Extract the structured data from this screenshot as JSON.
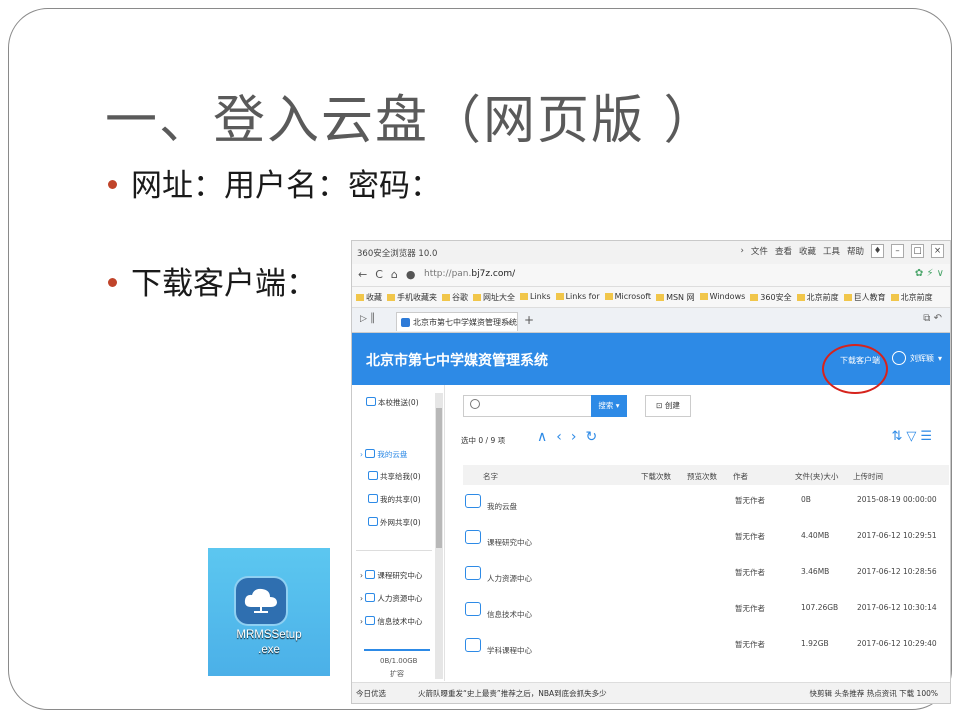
{
  "slide": {
    "title": "一、登入云盘（网页版 ）",
    "bullets": [
      "网址：用户名：密码：",
      "下载客户端："
    ]
  },
  "exe_file": {
    "name_line1": "MRMSSetup",
    "name_line2": ".exe",
    "icon": "cloud-setup-icon"
  },
  "browser": {
    "app_title": "360安全浏览器 10.0",
    "menu": [
      "文件",
      "查看",
      "收藏",
      "工具",
      "帮助"
    ],
    "url_prefix": "http://pan.",
    "url_domain": "bj7z.com/",
    "favorites": [
      "收藏",
      "手机收藏夹",
      "谷歌",
      "网址大全",
      "Links",
      "Links for",
      "Microsoft",
      "MSN 网",
      "Windows",
      "360安全",
      "北京前度",
      "巨人教育",
      "北京前度"
    ],
    "tab_title": "北京市第七中学媒资管理系统",
    "accent_color": "#2d8ae6"
  },
  "app": {
    "header_title": "北京市第七中学媒资管理系统",
    "download_client": "下载客户端",
    "user_name": "刘辉颖",
    "sidebar": {
      "school_push": "本校推送(0)",
      "my_disk": "我的云盘",
      "shared_to_me": "共享给我(0)",
      "my_shares": "我的共享(0)",
      "external_shares": "外网共享(0)",
      "groups": [
        "课程研究中心",
        "人力资源中心",
        "信息技术中心"
      ],
      "quota": "0B/1.00GB",
      "expand": "扩容"
    },
    "toolbar": {
      "search_button": "搜索",
      "create_button": "创建"
    },
    "selection": "选中 0 / 9 项",
    "columns": [
      "名字",
      "下载次数",
      "预览次数",
      "作者",
      "文件(夹)大小",
      "上传时间"
    ],
    "rows": [
      {
        "name": "我的云盘",
        "author": "暂无作者",
        "size": "0B",
        "time": "2015-08-19 00:00:00"
      },
      {
        "name": "课程研究中心",
        "author": "暂无作者",
        "size": "4.40MB",
        "time": "2017-06-12 10:29:51"
      },
      {
        "name": "人力资源中心",
        "author": "暂无作者",
        "size": "3.46MB",
        "time": "2017-06-12 10:28:56"
      },
      {
        "name": "信息技术中心",
        "author": "暂无作者",
        "size": "107.26GB",
        "time": "2017-06-12 10:30:14"
      },
      {
        "name": "学科课程中心",
        "author": "暂无作者",
        "size": "1.92GB",
        "time": "2017-06-12 10:29:40"
      }
    ]
  },
  "statusbar": {
    "today": "今日优选",
    "news": "火箭队曝重发“史上最贵”推荐之后，NBA到底会抓失多少",
    "right": "快剪辑  头条推荐  热点资讯  下载  100%"
  }
}
